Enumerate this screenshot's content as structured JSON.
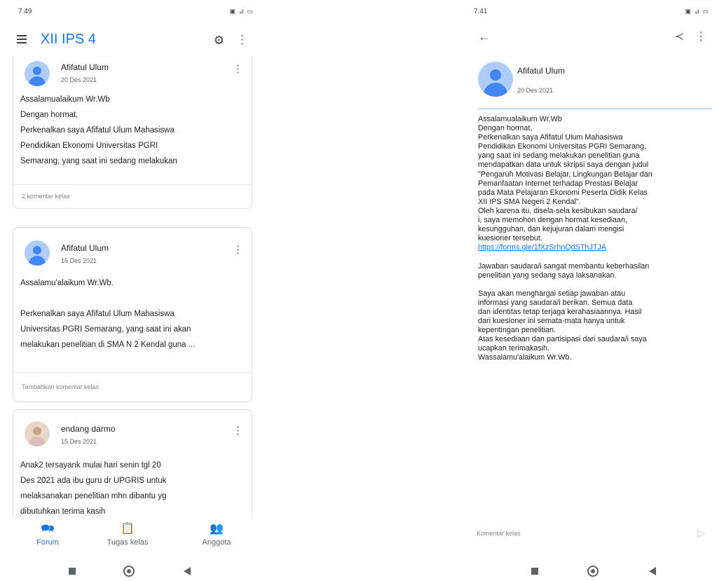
{
  "left": {
    "status": {
      "time": "7.49",
      "icons": "▣ ⊿ ▭"
    },
    "header": {
      "class_name": "XII IPS 4",
      "settings_icon": "gear-icon",
      "menu_icon": "more-vert-icon"
    },
    "posts": [
      {
        "author": "Afifatul Ulum",
        "date": "20 Des 2021",
        "body": "Assalamualaikum Wr.Wb\nDengan hormat,\nPerkenalkan saya Afifatul Ulum Mahasiswa\nPendidikan Ekonomi Universitas PGRI\nSemarang, yang saat ini sedang melakukan",
        "footer": "2 komentar kelas"
      },
      {
        "author": "Afifatul Ulum",
        "date": "16 Des 2021",
        "body": "Assalamu'alaikum Wr.Wb.\n\nPerkenalkan saya Afifatul Ulum Mahasiswa\nUniversitas PGRI Semarang, yang saat ini akan\nmelakukan penelitian di SMA N 2 Kendal guna ...",
        "footer": "Tambahkan komentar kelas"
      },
      {
        "author": "endang darmo",
        "date": "15 Des 2021",
        "body": "Anak2 tersayank mulai hari senin tgl 20\nDes 2021 ada ibu guru dr UPGRIS untuk\nmelaksanakan penelitian mhn dibantu yg\ndibutuhkan terima kasih",
        "footer": ""
      }
    ],
    "nav": [
      {
        "label": "Forum",
        "icon": "forum-icon",
        "active": true
      },
      {
        "label": "Tugas kelas",
        "icon": "assignment-icon",
        "active": false
      },
      {
        "label": "Anggota",
        "icon": "people-icon",
        "active": false
      }
    ]
  },
  "right": {
    "status": {
      "time": "7.41",
      "icons": "▣ ⊿ ▭"
    },
    "toolbar": {
      "back_icon": "back-arrow-icon",
      "share_icon": "share-icon",
      "menu_icon": "more-vert-icon"
    },
    "post": {
      "author": "Afifatul Ulum",
      "date": "20 Des 2021",
      "body_before_link": "Assalamualaikum Wr.Wb\nDengan hormat,\nPerkenalkan saya Afifatul Ulum Mahasiswa\nPendidikan Ekonomi Universitas PGRI Semarang,\nyang saat ini sedang melakukan penelitian guna\nmendapatkan data untuk skripsi saya dengan judul\n\"Pengaruh Motivasi Belajar, Lingkungan Belajar dan\nPemanfaatan Internet terhadap Prestasi Belajar\npada Mata Pelajaran Ekonomi Peserta Didik Kelas\nXII IPS SMA Negeri 2 Kendal\".\nOleh karena itu, disela-sela kesibukan saudara/\ni, saya memohon dengan hormat kesediaan,\nkesungguhan, dan kejujuran dalam mengisi\nkuesioner tersebut.",
      "link": "https://forms.gle/1fXzSrhnQdSThJTJA",
      "body_after_link": "\n\nJawaban saudara/i sangat membantu keberhasilan\npenelitian yang sedang saya laksanakan.\n\nSaya akan menghargai setiap jawaban atau\ninformasi yang saudara/i berikan. Semua data\ndan identitas tetap terjaga kerahasiaannya. Hasil\ndari kuesioner ini semata-mata hanya untuk\nkepentingan penelitian.\nAtas kesediaan dan partisipasi dari saudara/i saya\nucapkan terimakasih.\nWassalamu'alaikum Wr.Wb."
    },
    "comment": {
      "placeholder": "Komentar kelas",
      "send_icon": "send-icon"
    }
  },
  "colors": {
    "accent": "#1a73e8",
    "avatar_bg": "#aecbfa",
    "avatar_fg": "#4285f4"
  }
}
